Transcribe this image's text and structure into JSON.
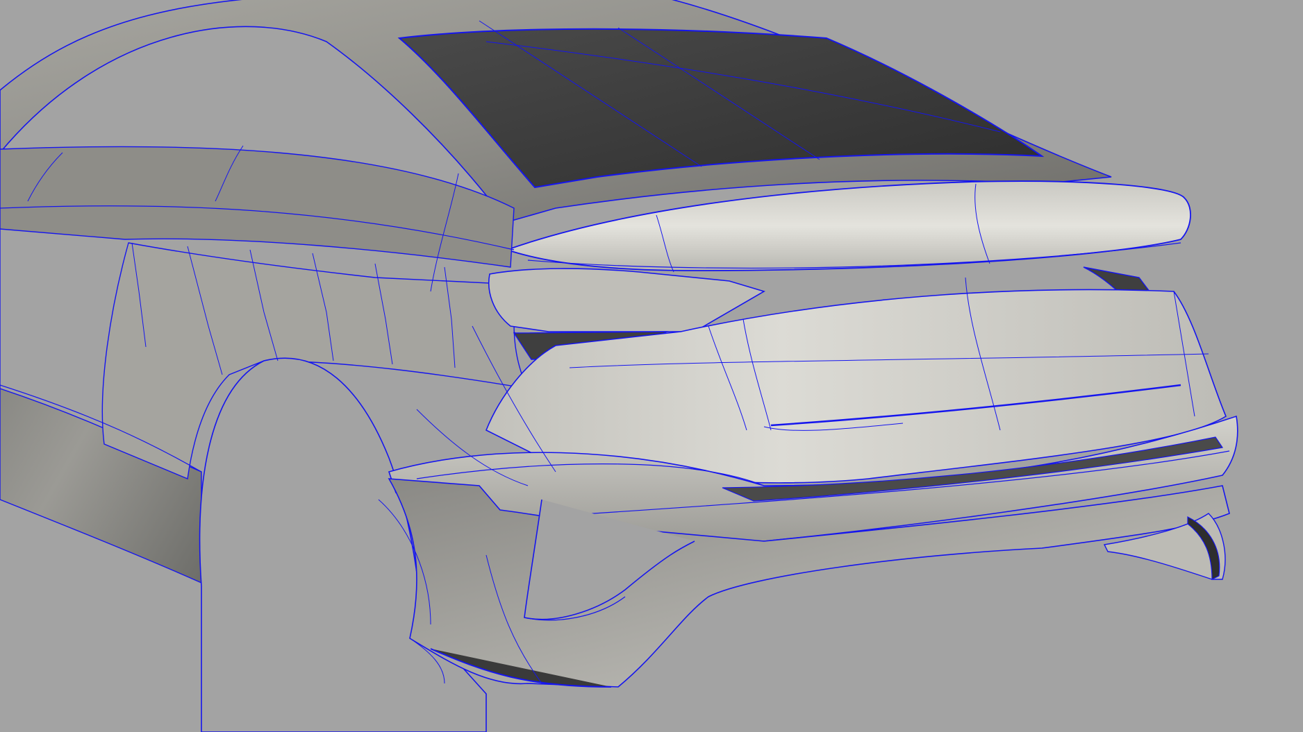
{
  "viewport": {
    "view": "perspective",
    "display_mode": "shaded-with-isoparms",
    "colors": {
      "background": "#a3a3a3",
      "isoparm": "#1515ee",
      "surface_light": "#d9d8d2",
      "surface_mid": "#a9a8a3",
      "surface_dark": "#6a6a66",
      "glass_dark": "#3a3a3a"
    }
  },
  "model": {
    "subject": "car-rear-body-surfaces",
    "parts": [
      "roof",
      "rear-window",
      "trunk-spoiler",
      "tail-lights",
      "rear-fascia",
      "rear-bumper",
      "diffuser",
      "rear-quarter-panel",
      "wheel-arch"
    ]
  }
}
